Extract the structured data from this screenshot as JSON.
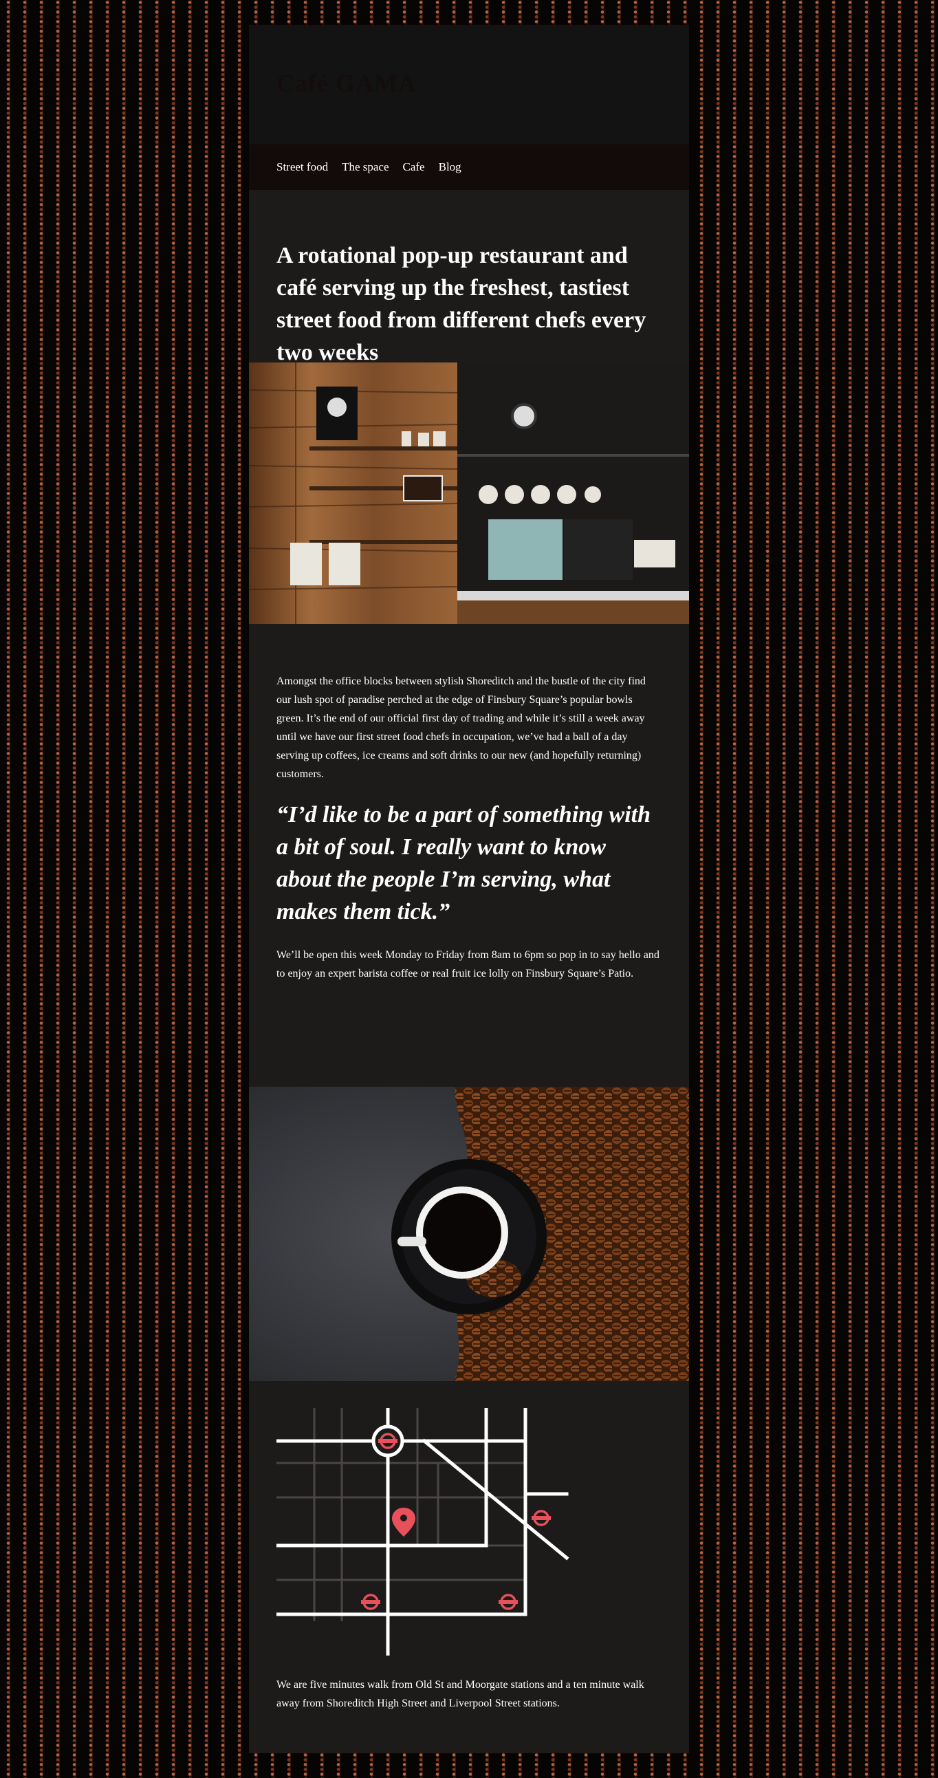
{
  "site": {
    "name": "Café GAMA"
  },
  "nav": {
    "items": [
      "Street food",
      "The space",
      "Cafe",
      "Blog"
    ]
  },
  "hero": {
    "title": "A rotational pop-up restaurant and café serving up the freshest, tastiest street food from different chefs every two weeks"
  },
  "content": {
    "intro": "Amongst the office blocks between stylish Shoreditch and the bustle of the city find our lush spot of paradise perched at the edge of Finsbury Square’s popular bowls green. It’s the end of our official first day of trading and while it’s still a week away until we have our first street food chefs in occupation, we’ve had a ball of a day serving up coffees, ice creams and soft drinks to our new (and hopefully returning) customers.",
    "quote": "“I’d like to be a part of something with a bit of soul. I really want to know about the people I’m serving, what makes them tick.”",
    "opening": "We’ll be open this week Monday to Friday from 8am to 6pm so pop in to say hello and to enjoy an expert barista coffee or real fruit ice lolly on Finsbury Square’s Patio.",
    "location": "We are five minutes walk from Old St and Moorgate stations and a ten minute walk away from Shoreditch High Street and Liverpool Street stations."
  },
  "colors": {
    "page_bg": "#1d1a1a",
    "header_bg": "#131313",
    "nav_bg": "#120b09",
    "accent": "#e8505b"
  },
  "icons": {
    "station": "underground-roundel-icon",
    "pin": "map-pin-icon"
  }
}
